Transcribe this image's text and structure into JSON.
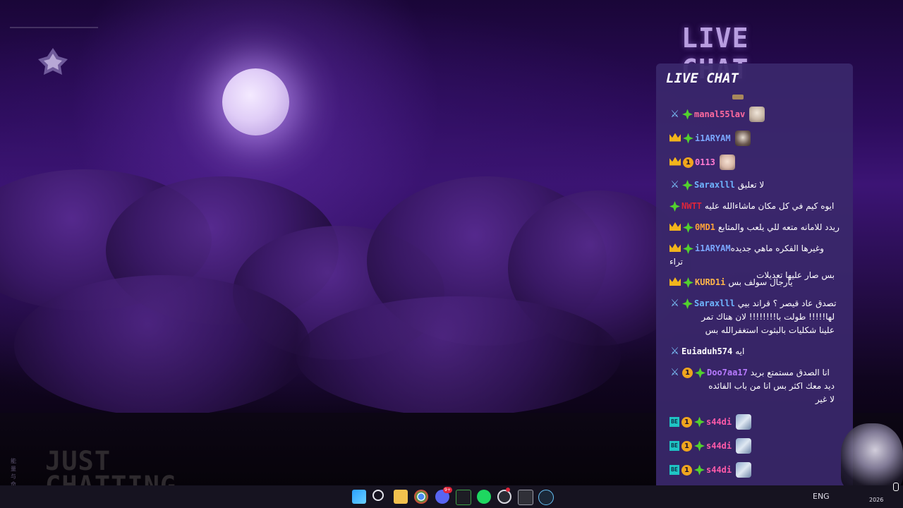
{
  "overlay": {
    "header_title": "LIVE CHAT",
    "scene_label": "JUST CHATTING",
    "side_glyphs": "能 量 与 命"
  },
  "chat": {
    "title": "LIVE CHAT",
    "messages": [
      {
        "user": "manal55lav",
        "color": "#ff6a9e",
        "badges": [
          "sword-icon",
          "diamond-icon"
        ],
        "text": "",
        "avatar": "anime-avatar-1"
      },
      {
        "user": "i1ARYAM",
        "color": "#7aa7ff",
        "badges": [
          "crown-icon",
          "diamond-icon"
        ],
        "text": "",
        "avatar": "anime-avatar-2"
      },
      {
        "user": "0113",
        "color": "#ff7ad1",
        "badges": [
          "crown-icon",
          "one-icon"
        ],
        "text": "",
        "avatar": "anime-avatar-3"
      },
      {
        "user": "Saraxlll",
        "color": "#6fb5ff",
        "badges": [
          "sword-icon",
          "diamond-icon"
        ],
        "text": "لا تعليق"
      },
      {
        "user": "NWTT",
        "color": "#e0253a",
        "badges": [
          "diamond-icon"
        ],
        "text": "ايوه كيم في كل مكان ماشاءالله عليه"
      },
      {
        "user": "0MD1",
        "color": "#ffa23a",
        "badges": [
          "crown-icon",
          "diamond-icon"
        ],
        "text": "ريدد للامانه متعه للي يلعب والمتابع"
      },
      {
        "user": "i1ARYAM",
        "color": "#7aa7ff",
        "badges": [
          "crown-icon",
          "diamond-icon"
        ],
        "text": "وغيرها الفكره ماهي جديده تراء",
        "text2": "بس صار عليها تعديلات"
      },
      {
        "user": "KURD1i",
        "color": "#ffb54a",
        "badges": [
          "crown-icon",
          "diamond-icon"
        ],
        "text": "يارجال سولف بس"
      },
      {
        "user": "Saraxlll",
        "color": "#6fb5ff",
        "badges": [
          "sword-icon",
          "diamond-icon"
        ],
        "text": "تصدق عاد قيصر ؟ قراند بيي",
        "text2": "لها!!!!! طولت با!!!!!!!! لان هناك تمر",
        "text3": "علينا شكليات بالبثوت استغفرالله بس"
      },
      {
        "user": "Euiaduh574",
        "color": "#ffffff",
        "badges": [
          "sword-icon"
        ],
        "text": "ايه"
      },
      {
        "user": "Doo7aa17",
        "color": "#b77aff",
        "badges": [
          "sword-icon",
          "one-icon",
          "diamond-icon"
        ],
        "text": "انا الصدق مستمتع بريد",
        "text2": "ديد معك اكثر بس انا من باب الفائده",
        "text3": "لا غير"
      },
      {
        "user": "s44di",
        "color": "#ff5aa8",
        "badges": [
          "teal-badge-icon",
          "one-icon",
          "diamond-icon"
        ],
        "text": "",
        "avatar": "anime-avatar-4"
      },
      {
        "user": "s44di",
        "color": "#ff5aa8",
        "badges": [
          "teal-badge-icon",
          "one-icon",
          "diamond-icon"
        ],
        "text": "",
        "avatar": "anime-avatar-4"
      },
      {
        "user": "s44di",
        "color": "#ff5aa8",
        "badges": [
          "teal-badge-icon",
          "one-icon",
          "diamond-icon"
        ],
        "text": "",
        "avatar": "anime-avatar-4"
      }
    ]
  },
  "taskbar": {
    "apps": [
      "windows-start-icon",
      "search-icon",
      "file-explorer-icon",
      "chrome-icon",
      "discord-icon",
      "xbox-icon",
      "spotify-icon",
      "obs-icon",
      "terminal-icon",
      "steam-icon"
    ],
    "discord_badge": "9+",
    "language": "ENG",
    "year": "2026"
  },
  "colors": {
    "panel": "#3a286c",
    "accent": "#b89ee0"
  }
}
